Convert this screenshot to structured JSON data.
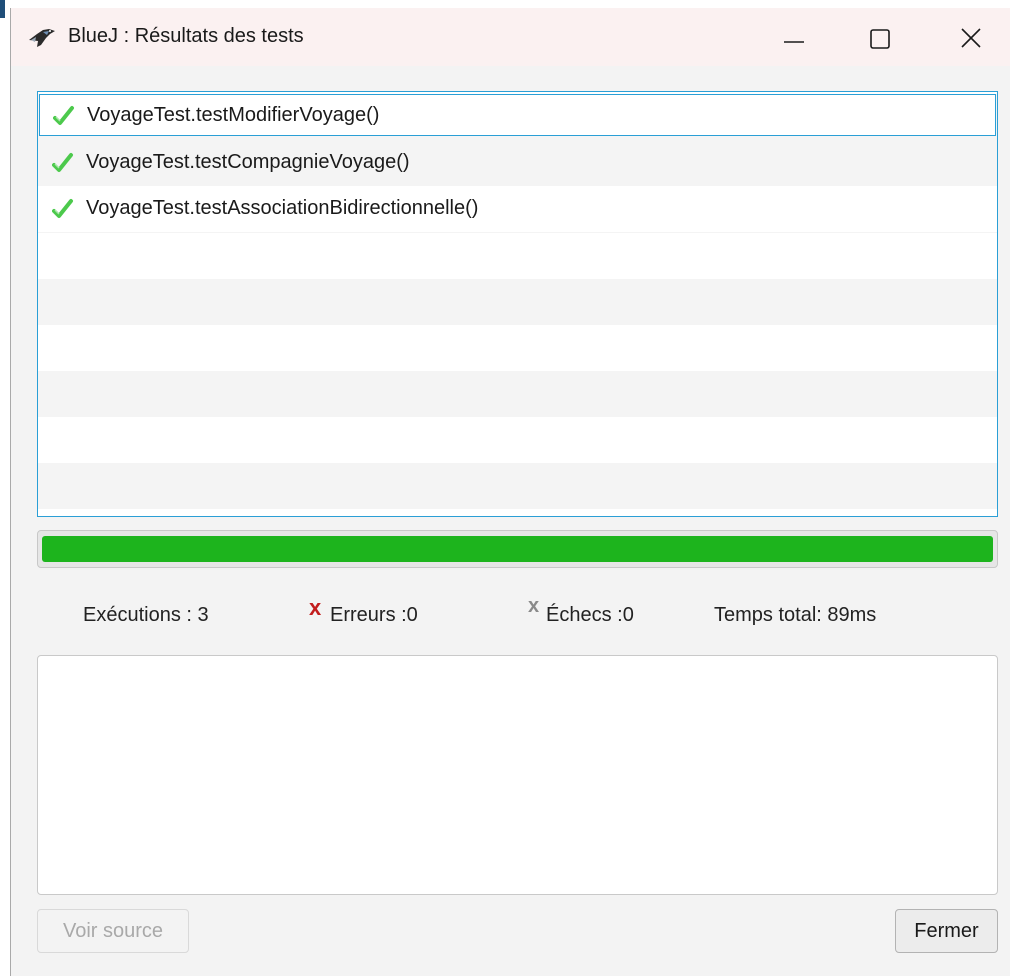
{
  "window": {
    "title": "BlueJ : Résultats des tests",
    "icon": "bluej-bird-icon"
  },
  "tests": [
    {
      "name": "VoyageTest.testModifierVoyage()",
      "status": "passed",
      "selected": true
    },
    {
      "name": "VoyageTest.testCompagnieVoyage()",
      "status": "passed",
      "selected": false
    },
    {
      "name": "VoyageTest.testAssociationBidirectionnelle()",
      "status": "passed",
      "selected": false
    }
  ],
  "progress": {
    "fraction": 1.0,
    "color": "#1db41d"
  },
  "stats": {
    "runs": "Exécutions :  3",
    "errors": "Erreurs :0",
    "errors_icon": "x",
    "failures": "Échecs :0",
    "failures_icon": "x",
    "total_time": "Temps total:  89ms"
  },
  "details": {
    "text": ""
  },
  "buttons": {
    "view_source": "Voir source",
    "close": "Fermer"
  },
  "colors": {
    "selection_border": "#2a9fd6",
    "error_red": "#c21d1d",
    "failure_gray": "#8a8a8a"
  }
}
